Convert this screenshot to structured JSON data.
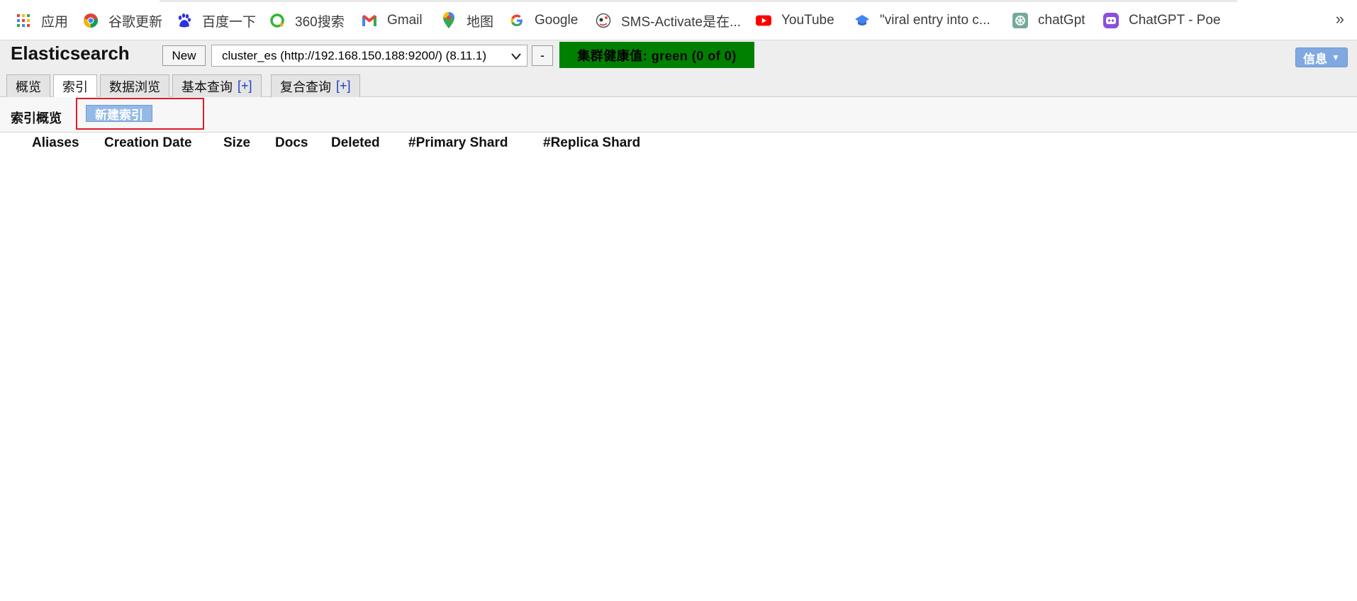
{
  "bookmarks": [
    {
      "label": "应用",
      "icon": "apps-grid-icon"
    },
    {
      "label": "谷歌更新",
      "icon": "chrome-icon"
    },
    {
      "label": "百度一下",
      "icon": "baidu-icon"
    },
    {
      "label": "360搜索",
      "icon": "360-search-icon"
    },
    {
      "label": "Gmail",
      "icon": "gmail-icon"
    },
    {
      "label": "地图",
      "icon": "maps-pin-icon"
    },
    {
      "label": "Google",
      "icon": "google-icon"
    },
    {
      "label": "SMS-Activate是在...",
      "icon": "sms-activate-icon"
    },
    {
      "label": "YouTube",
      "icon": "youtube-icon"
    },
    {
      "label": "\"viral entry into c...",
      "icon": "scholar-cap-icon"
    },
    {
      "label": "chatGpt",
      "icon": "openai-icon"
    },
    {
      "label": "ChatGPT - Poe",
      "icon": "poe-icon"
    }
  ],
  "bookmarks_more": "»",
  "header": {
    "title": "Elasticsearch",
    "new_label": "New",
    "cluster_value": "cluster_es (http://192.168.150.188:9200/) (8.11.1)",
    "minus_label": "-",
    "health_label": "集群健康值: green (0 of 0)",
    "info_label": "信息"
  },
  "tabs": [
    {
      "label": "概览",
      "plus": ""
    },
    {
      "label": "索引",
      "plus": ""
    },
    {
      "label": "数据浏览",
      "plus": ""
    },
    {
      "label": "基本查询",
      "plus": "[+]"
    },
    {
      "label": "复合查询",
      "plus": "[+]"
    }
  ],
  "index_panel": {
    "title": "索引概览",
    "new_index_label": "新建索引"
  },
  "table": {
    "columns": [
      "Aliases",
      "Creation Date",
      "Size",
      "Docs",
      "Deleted",
      "#Primary Shard",
      "#Replica Shard"
    ]
  },
  "colors": {
    "health_green": "#008000",
    "highlight_red": "#e01b24",
    "new_index_blue": "#93b9e6",
    "info_blue": "#7fa9e0"
  }
}
